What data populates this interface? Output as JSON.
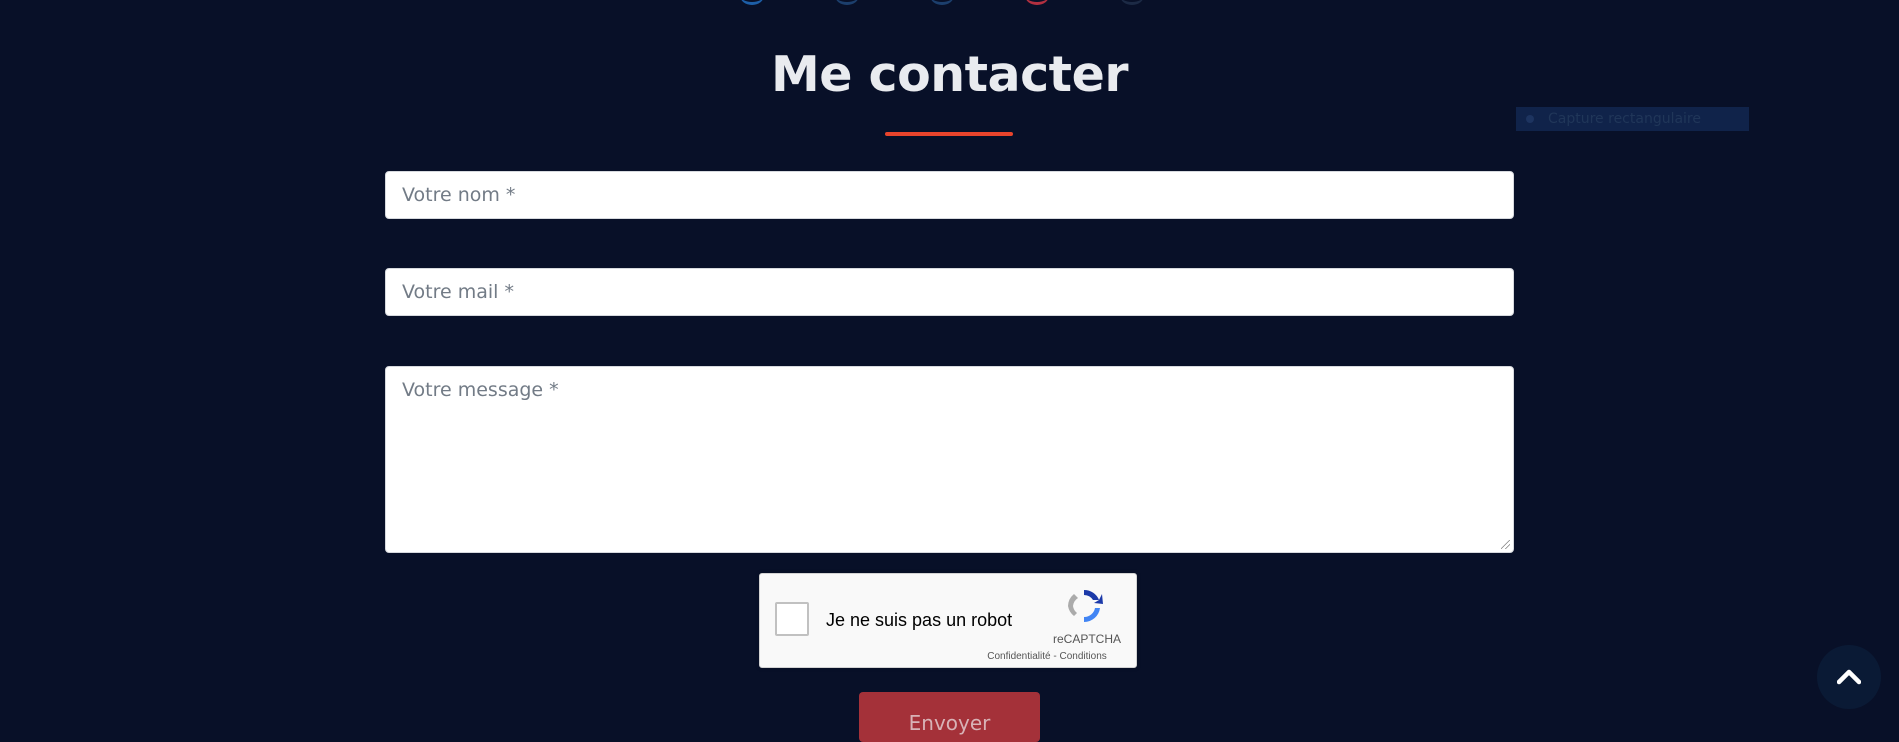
{
  "section": {
    "title": "Me contacter",
    "accent_color": "#e9442c",
    "background_color": "#081028"
  },
  "overlay": {
    "capture_label": "Capture rectangulaire"
  },
  "form": {
    "name_placeholder": "Votre nom *",
    "mail_placeholder": "Votre mail *",
    "message_placeholder": "Votre message *",
    "name_value": "",
    "mail_value": "",
    "message_value": "",
    "submit_label": "Envoyer",
    "submit_color": "#a43139"
  },
  "recaptcha": {
    "label": "Je ne suis pas un robot",
    "brand": "reCAPTCHA",
    "privacy_link": "Confidentialité",
    "separator": "-",
    "terms_link": "Conditions",
    "checked": false
  },
  "icons": {
    "social": [
      "social-icon-1",
      "social-icon-2",
      "social-icon-3",
      "social-icon-4",
      "social-icon-5"
    ],
    "scroll_top": "chevron-up-icon",
    "recaptcha_logo": "recaptcha-logo-icon"
  }
}
